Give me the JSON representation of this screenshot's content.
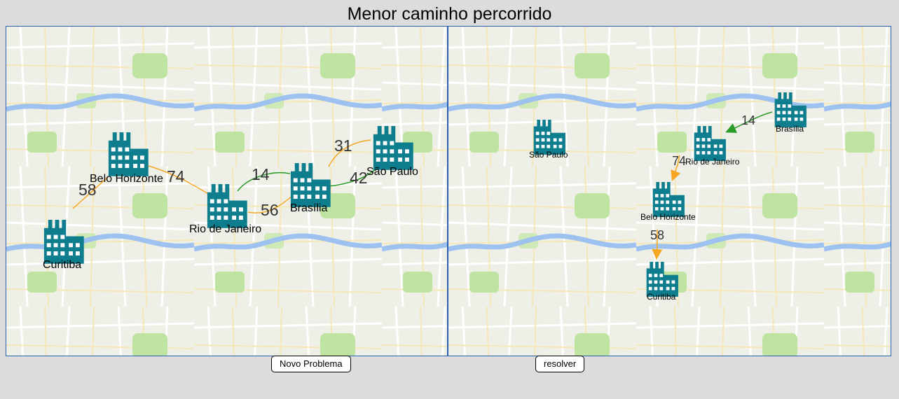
{
  "title": "Menor caminho percorrido",
  "buttons": {
    "novo": "Novo Problema",
    "resolver": "resolver"
  },
  "colors": {
    "node": "#0e7d8e",
    "edge_orange": "#f5a623",
    "edge_green": "#2a9c2a",
    "border": "#2b5fb4",
    "river": "#9ec2f0",
    "park": "#bfe3a1"
  },
  "graph": {
    "nodes": [
      {
        "id": "curitiba",
        "label": "Curitiba"
      },
      {
        "id": "bh",
        "label": "Belo Horizonte"
      },
      {
        "id": "rio",
        "label": "Rio de Janeiro"
      },
      {
        "id": "brasilia",
        "label": "Brasília"
      },
      {
        "id": "sp",
        "label": "São Paulo"
      }
    ],
    "edges": [
      {
        "from": "curitiba",
        "to": "bh",
        "weight": "58",
        "color": "orange"
      },
      {
        "from": "bh",
        "to": "rio",
        "weight": "74",
        "color": "orange"
      },
      {
        "from": "rio",
        "to": "brasilia",
        "weight": "14",
        "color": "green"
      },
      {
        "from": "rio",
        "to": "brasilia",
        "weight": "56",
        "color": "orange"
      },
      {
        "from": "brasilia",
        "to": "sp",
        "weight": "31",
        "color": "orange"
      },
      {
        "from": "brasilia",
        "to": "sp",
        "weight": "42",
        "color": "green"
      }
    ]
  },
  "solution": {
    "nodes": [
      {
        "id": "sp",
        "label": "São Paulo"
      },
      {
        "id": "brasilia",
        "label": "Brasília"
      },
      {
        "id": "rio",
        "label": "Rio de Janeiro"
      },
      {
        "id": "bh",
        "label": "Belo Horizonte"
      },
      {
        "id": "curitiba",
        "label": "Curitiba"
      }
    ],
    "edges": [
      {
        "from": "brasilia",
        "to": "rio",
        "weight": "14",
        "color": "green"
      },
      {
        "from": "rio",
        "to": "bh",
        "weight": "74",
        "color": "orange"
      },
      {
        "from": "bh",
        "to": "curitiba",
        "weight": "58",
        "color": "orange"
      }
    ]
  }
}
